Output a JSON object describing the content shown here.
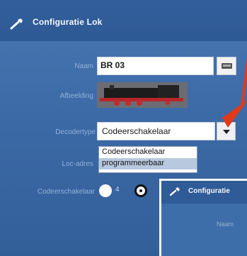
{
  "window": {
    "title": "Configuratie Lok"
  },
  "form": {
    "name_label": "Naam",
    "name_value": "BR 03",
    "image_label": "Afbeelding",
    "decoder_label": "Decodertype",
    "decoder_value": "Codeerschakelaar",
    "decoder_options": [
      "Codeerschakelaar",
      "programmeerbaar"
    ],
    "address_label": "Loc-adres",
    "switch_label": "Codeerschakelaar",
    "switch_value": "4"
  },
  "overlay": {
    "title": "Configuratie",
    "name_label": "Naam"
  },
  "colors": {
    "panel": "#3c6aa6",
    "titlebar": "#2e5994",
    "label": "#8fb2dc",
    "arrow": "#e03a1c"
  },
  "icons": {
    "title": "wrench-icon",
    "keyboard": "keyboard-icon",
    "dropdown": "chevron-down-icon"
  }
}
